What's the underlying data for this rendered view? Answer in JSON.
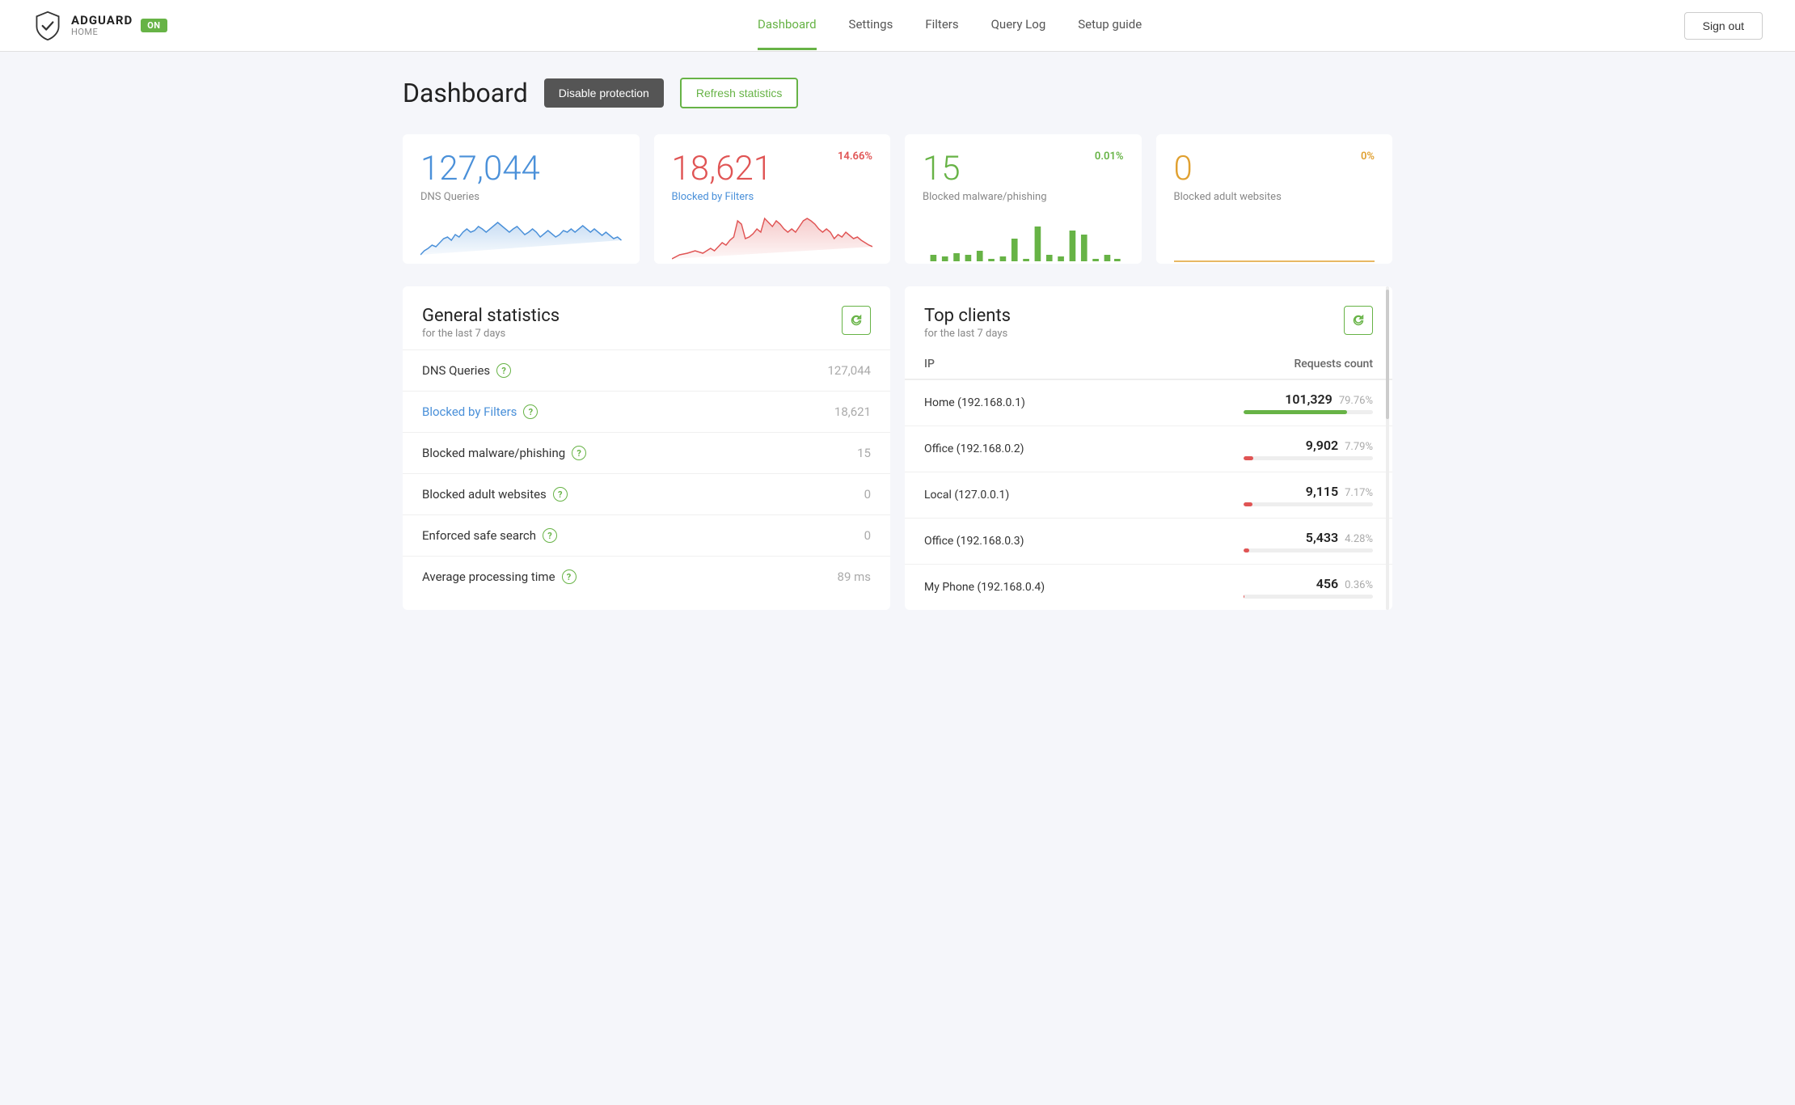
{
  "brand": {
    "name": "ADGUARD",
    "sub": "HOME",
    "badge": "ON"
  },
  "nav": {
    "links": [
      {
        "label": "Dashboard",
        "active": true
      },
      {
        "label": "Settings",
        "active": false
      },
      {
        "label": "Filters",
        "active": false
      },
      {
        "label": "Query Log",
        "active": false
      },
      {
        "label": "Setup guide",
        "active": false
      }
    ],
    "sign_out": "Sign out"
  },
  "page": {
    "title": "Dashboard",
    "btn_disable": "Disable protection",
    "btn_refresh": "Refresh statistics"
  },
  "stat_cards": [
    {
      "number": "127,044",
      "color": "blue",
      "label": "DNS Queries",
      "label_color": "",
      "percent": "",
      "percent_color": ""
    },
    {
      "number": "18,621",
      "color": "red",
      "label": "Blocked by Filters",
      "label_color": "blue",
      "percent": "14.66%",
      "percent_color": "red"
    },
    {
      "number": "15",
      "color": "green",
      "label": "Blocked malware/phishing",
      "label_color": "",
      "percent": "0.01%",
      "percent_color": "green"
    },
    {
      "number": "0",
      "color": "yellow",
      "label": "Blocked adult websites",
      "label_color": "",
      "percent": "0%",
      "percent_color": "yellow"
    }
  ],
  "general_stats": {
    "title": "General statistics",
    "subtitle": "for the last 7 days",
    "rows": [
      {
        "label": "DNS Queries",
        "is_link": false,
        "value": "127,044"
      },
      {
        "label": "Blocked by Filters",
        "is_link": true,
        "value": "18,621"
      },
      {
        "label": "Blocked malware/phishing",
        "is_link": false,
        "value": "15"
      },
      {
        "label": "Blocked adult websites",
        "is_link": false,
        "value": "0"
      },
      {
        "label": "Enforced safe search",
        "is_link": false,
        "value": "0"
      },
      {
        "label": "Average processing time",
        "is_link": false,
        "value": "89 ms"
      }
    ]
  },
  "top_clients": {
    "title": "Top clients",
    "subtitle": "for the last 7 days",
    "col_ip": "IP",
    "col_requests": "Requests count",
    "rows": [
      {
        "ip": "Home (192.168.0.1)",
        "count": "101,329",
        "pct": "79.76%",
        "bar": 79.76,
        "bar_color": "green"
      },
      {
        "ip": "Office (192.168.0.2)",
        "count": "9,902",
        "pct": "7.79%",
        "bar": 7.79,
        "bar_color": "red"
      },
      {
        "ip": "Local (127.0.0.1)",
        "count": "9,115",
        "pct": "7.17%",
        "bar": 7.17,
        "bar_color": "red"
      },
      {
        "ip": "Office (192.168.0.3)",
        "count": "5,433",
        "pct": "4.28%",
        "bar": 4.28,
        "bar_color": "red"
      },
      {
        "ip": "My Phone (192.168.0.4)",
        "count": "456",
        "pct": "0.36%",
        "bar": 0.36,
        "bar_color": "red"
      }
    ]
  }
}
